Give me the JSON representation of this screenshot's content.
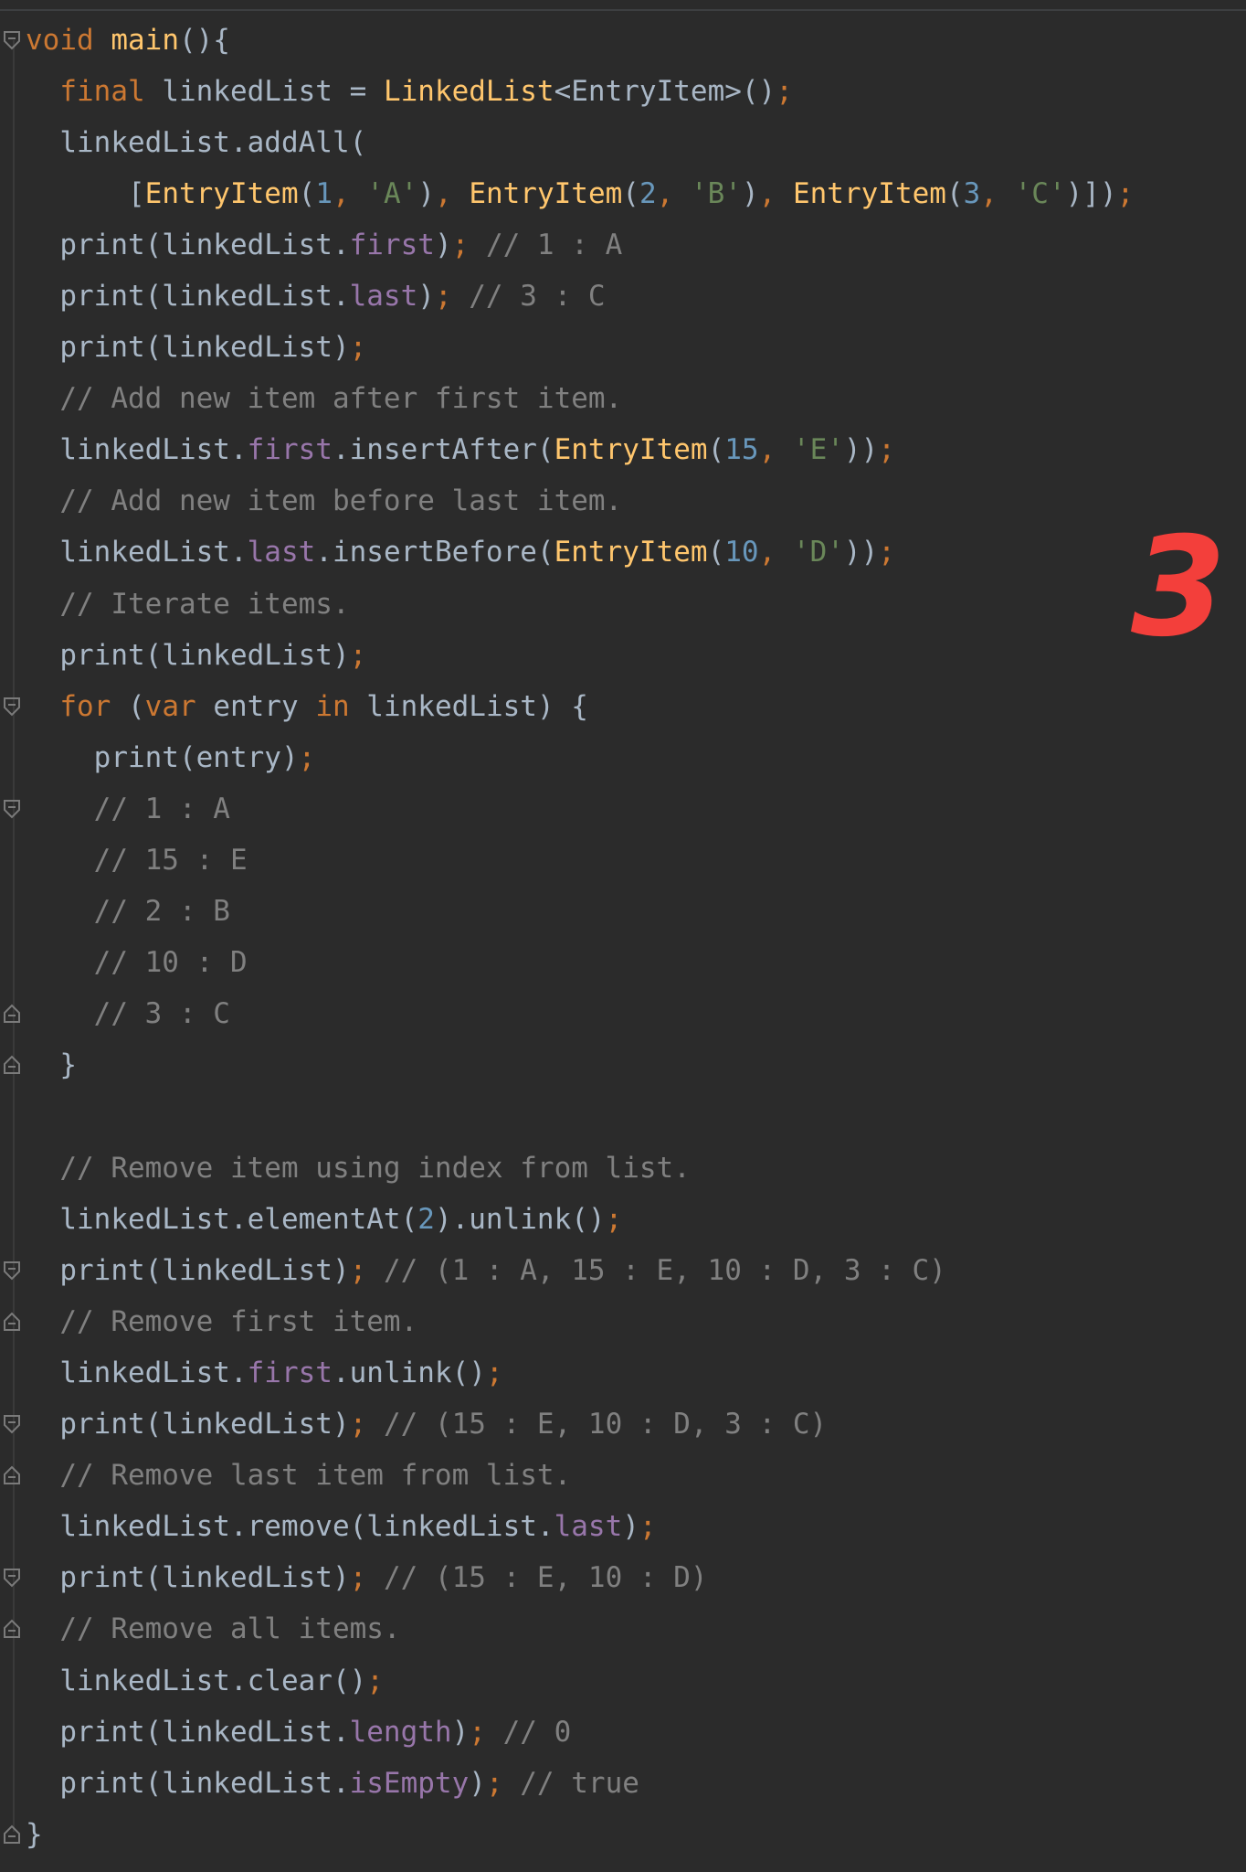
{
  "editor": {
    "lines": [
      {
        "tokens": [
          [
            "kw",
            "void"
          ],
          [
            "pl",
            " "
          ],
          [
            "cls",
            "main"
          ],
          [
            "pl",
            "(){"
          ]
        ],
        "fold": "open"
      },
      {
        "tokens": [
          [
            "pl",
            "  "
          ],
          [
            "kw",
            "final"
          ],
          [
            "pl",
            " linkedList = "
          ],
          [
            "cls",
            "LinkedList"
          ],
          [
            "pl",
            "<EntryItem>()"
          ],
          [
            "kw",
            ";"
          ]
        ]
      },
      {
        "tokens": [
          [
            "pl",
            "  linkedList.addAll("
          ]
        ]
      },
      {
        "tokens": [
          [
            "pl",
            "      ["
          ],
          [
            "cls",
            "EntryItem"
          ],
          [
            "pl",
            "("
          ],
          [
            "num",
            "1"
          ],
          [
            "kw",
            ", "
          ],
          [
            "str",
            "'A'"
          ],
          [
            "pl",
            ")"
          ],
          [
            "kw",
            ", "
          ],
          [
            "cls",
            "EntryItem"
          ],
          [
            "pl",
            "("
          ],
          [
            "num",
            "2"
          ],
          [
            "kw",
            ", "
          ],
          [
            "str",
            "'B'"
          ],
          [
            "pl",
            ")"
          ],
          [
            "kw",
            ", "
          ],
          [
            "cls",
            "EntryItem"
          ],
          [
            "pl",
            "("
          ],
          [
            "num",
            "3"
          ],
          [
            "kw",
            ", "
          ],
          [
            "str",
            "'C'"
          ],
          [
            "pl",
            ")])"
          ],
          [
            "kw",
            ";"
          ]
        ]
      },
      {
        "tokens": [
          [
            "pl",
            "  print(linkedList."
          ],
          [
            "prop",
            "first"
          ],
          [
            "pl",
            ")"
          ],
          [
            "kw",
            ";"
          ],
          [
            "cm",
            " // 1 : A"
          ]
        ]
      },
      {
        "tokens": [
          [
            "pl",
            "  print(linkedList."
          ],
          [
            "prop",
            "last"
          ],
          [
            "pl",
            ")"
          ],
          [
            "kw",
            ";"
          ],
          [
            "cm",
            " // 3 : C"
          ]
        ]
      },
      {
        "tokens": [
          [
            "pl",
            "  print(linkedList)"
          ],
          [
            "kw",
            ";"
          ]
        ]
      },
      {
        "tokens": [
          [
            "cm",
            "  // Add new item after first item."
          ]
        ]
      },
      {
        "tokens": [
          [
            "pl",
            "  linkedList."
          ],
          [
            "prop",
            "first"
          ],
          [
            "pl",
            ".insertAfter("
          ],
          [
            "cls",
            "EntryItem"
          ],
          [
            "pl",
            "("
          ],
          [
            "num",
            "15"
          ],
          [
            "kw",
            ", "
          ],
          [
            "str",
            "'E'"
          ],
          [
            "pl",
            "))"
          ],
          [
            "kw",
            ";"
          ]
        ]
      },
      {
        "tokens": [
          [
            "cm",
            "  // Add new item before last item."
          ]
        ]
      },
      {
        "tokens": [
          [
            "pl",
            "  linkedList."
          ],
          [
            "prop",
            "last"
          ],
          [
            "pl",
            ".insertBefore("
          ],
          [
            "cls",
            "EntryItem"
          ],
          [
            "pl",
            "("
          ],
          [
            "num",
            "10"
          ],
          [
            "kw",
            ", "
          ],
          [
            "str",
            "'D'"
          ],
          [
            "pl",
            "))"
          ],
          [
            "kw",
            ";"
          ]
        ]
      },
      {
        "tokens": [
          [
            "cm",
            "  // Iterate items."
          ]
        ]
      },
      {
        "tokens": [
          [
            "pl",
            "  print(linkedList)"
          ],
          [
            "kw",
            ";"
          ]
        ]
      },
      {
        "tokens": [
          [
            "pl",
            "  "
          ],
          [
            "kw",
            "for"
          ],
          [
            "pl",
            " ("
          ],
          [
            "kw",
            "var"
          ],
          [
            "pl",
            " entry "
          ],
          [
            "kw",
            "in"
          ],
          [
            "pl",
            " linkedList) {"
          ]
        ],
        "fold": "open"
      },
      {
        "tokens": [
          [
            "pl",
            "    print(entry)"
          ],
          [
            "kw",
            ";"
          ]
        ]
      },
      {
        "tokens": [
          [
            "cm",
            "    // 1 : A"
          ]
        ],
        "fold": "open"
      },
      {
        "tokens": [
          [
            "cm",
            "    // 15 : E"
          ]
        ]
      },
      {
        "tokens": [
          [
            "cm",
            "    // 2 : B"
          ]
        ]
      },
      {
        "tokens": [
          [
            "cm",
            "    // 10 : D"
          ]
        ]
      },
      {
        "tokens": [
          [
            "cm",
            "    // 3 : C"
          ]
        ],
        "fold": "close"
      },
      {
        "tokens": [
          [
            "pl",
            "  }"
          ]
        ],
        "fold": "close"
      },
      {
        "tokens": [
          [
            "pl",
            ""
          ]
        ]
      },
      {
        "tokens": [
          [
            "cm",
            "  // Remove item using index from list."
          ]
        ]
      },
      {
        "tokens": [
          [
            "pl",
            "  linkedList.elementAt("
          ],
          [
            "num",
            "2"
          ],
          [
            "pl",
            ").unlink()"
          ],
          [
            "kw",
            ";"
          ]
        ]
      },
      {
        "tokens": [
          [
            "pl",
            "  print(linkedList)"
          ],
          [
            "kw",
            ";"
          ],
          [
            "cm",
            " // (1 : A, 15 : E, 10 : D, 3 : C)"
          ]
        ],
        "fold": "open"
      },
      {
        "tokens": [
          [
            "cm",
            "  // Remove first item."
          ]
        ],
        "fold": "close"
      },
      {
        "tokens": [
          [
            "pl",
            "  linkedList."
          ],
          [
            "prop",
            "first"
          ],
          [
            "pl",
            ".unlink()"
          ],
          [
            "kw",
            ";"
          ]
        ]
      },
      {
        "tokens": [
          [
            "pl",
            "  print(linkedList)"
          ],
          [
            "kw",
            ";"
          ],
          [
            "cm",
            " // (15 : E, 10 : D, 3 : C)"
          ]
        ],
        "fold": "open"
      },
      {
        "tokens": [
          [
            "cm",
            "  // Remove last item from list."
          ]
        ],
        "fold": "close"
      },
      {
        "tokens": [
          [
            "pl",
            "  linkedList.remove(linkedList."
          ],
          [
            "prop",
            "last"
          ],
          [
            "pl",
            ")"
          ],
          [
            "kw",
            ";"
          ]
        ]
      },
      {
        "tokens": [
          [
            "pl",
            "  print(linkedList)"
          ],
          [
            "kw",
            ";"
          ],
          [
            "cm",
            " // (15 : E, 10 : D)"
          ]
        ],
        "fold": "open"
      },
      {
        "tokens": [
          [
            "cm",
            "  // Remove all items."
          ]
        ],
        "fold": "close"
      },
      {
        "tokens": [
          [
            "pl",
            "  linkedList.clear()"
          ],
          [
            "kw",
            ";"
          ]
        ]
      },
      {
        "tokens": [
          [
            "pl",
            "  print(linkedList."
          ],
          [
            "prop",
            "length"
          ],
          [
            "pl",
            ")"
          ],
          [
            "kw",
            ";"
          ],
          [
            "cm",
            " // 0"
          ]
        ]
      },
      {
        "tokens": [
          [
            "pl",
            "  print(linkedList."
          ],
          [
            "prop",
            "isEmpty"
          ],
          [
            "pl",
            ")"
          ],
          [
            "kw",
            ";"
          ],
          [
            "cm",
            " // true"
          ]
        ]
      },
      {
        "tokens": [
          [
            "pl",
            "}"
          ]
        ],
        "fold": "close"
      }
    ]
  },
  "badge": {
    "text": "3"
  },
  "colors": {
    "background": "#2b2b2b",
    "keyword": "#cc7832",
    "class_name": "#ffc66d",
    "number": "#6897bb",
    "string": "#6a8759",
    "property": "#9876aa",
    "comment": "#808080",
    "plain": "#a9b7c6",
    "badge": "#f33f3b"
  }
}
